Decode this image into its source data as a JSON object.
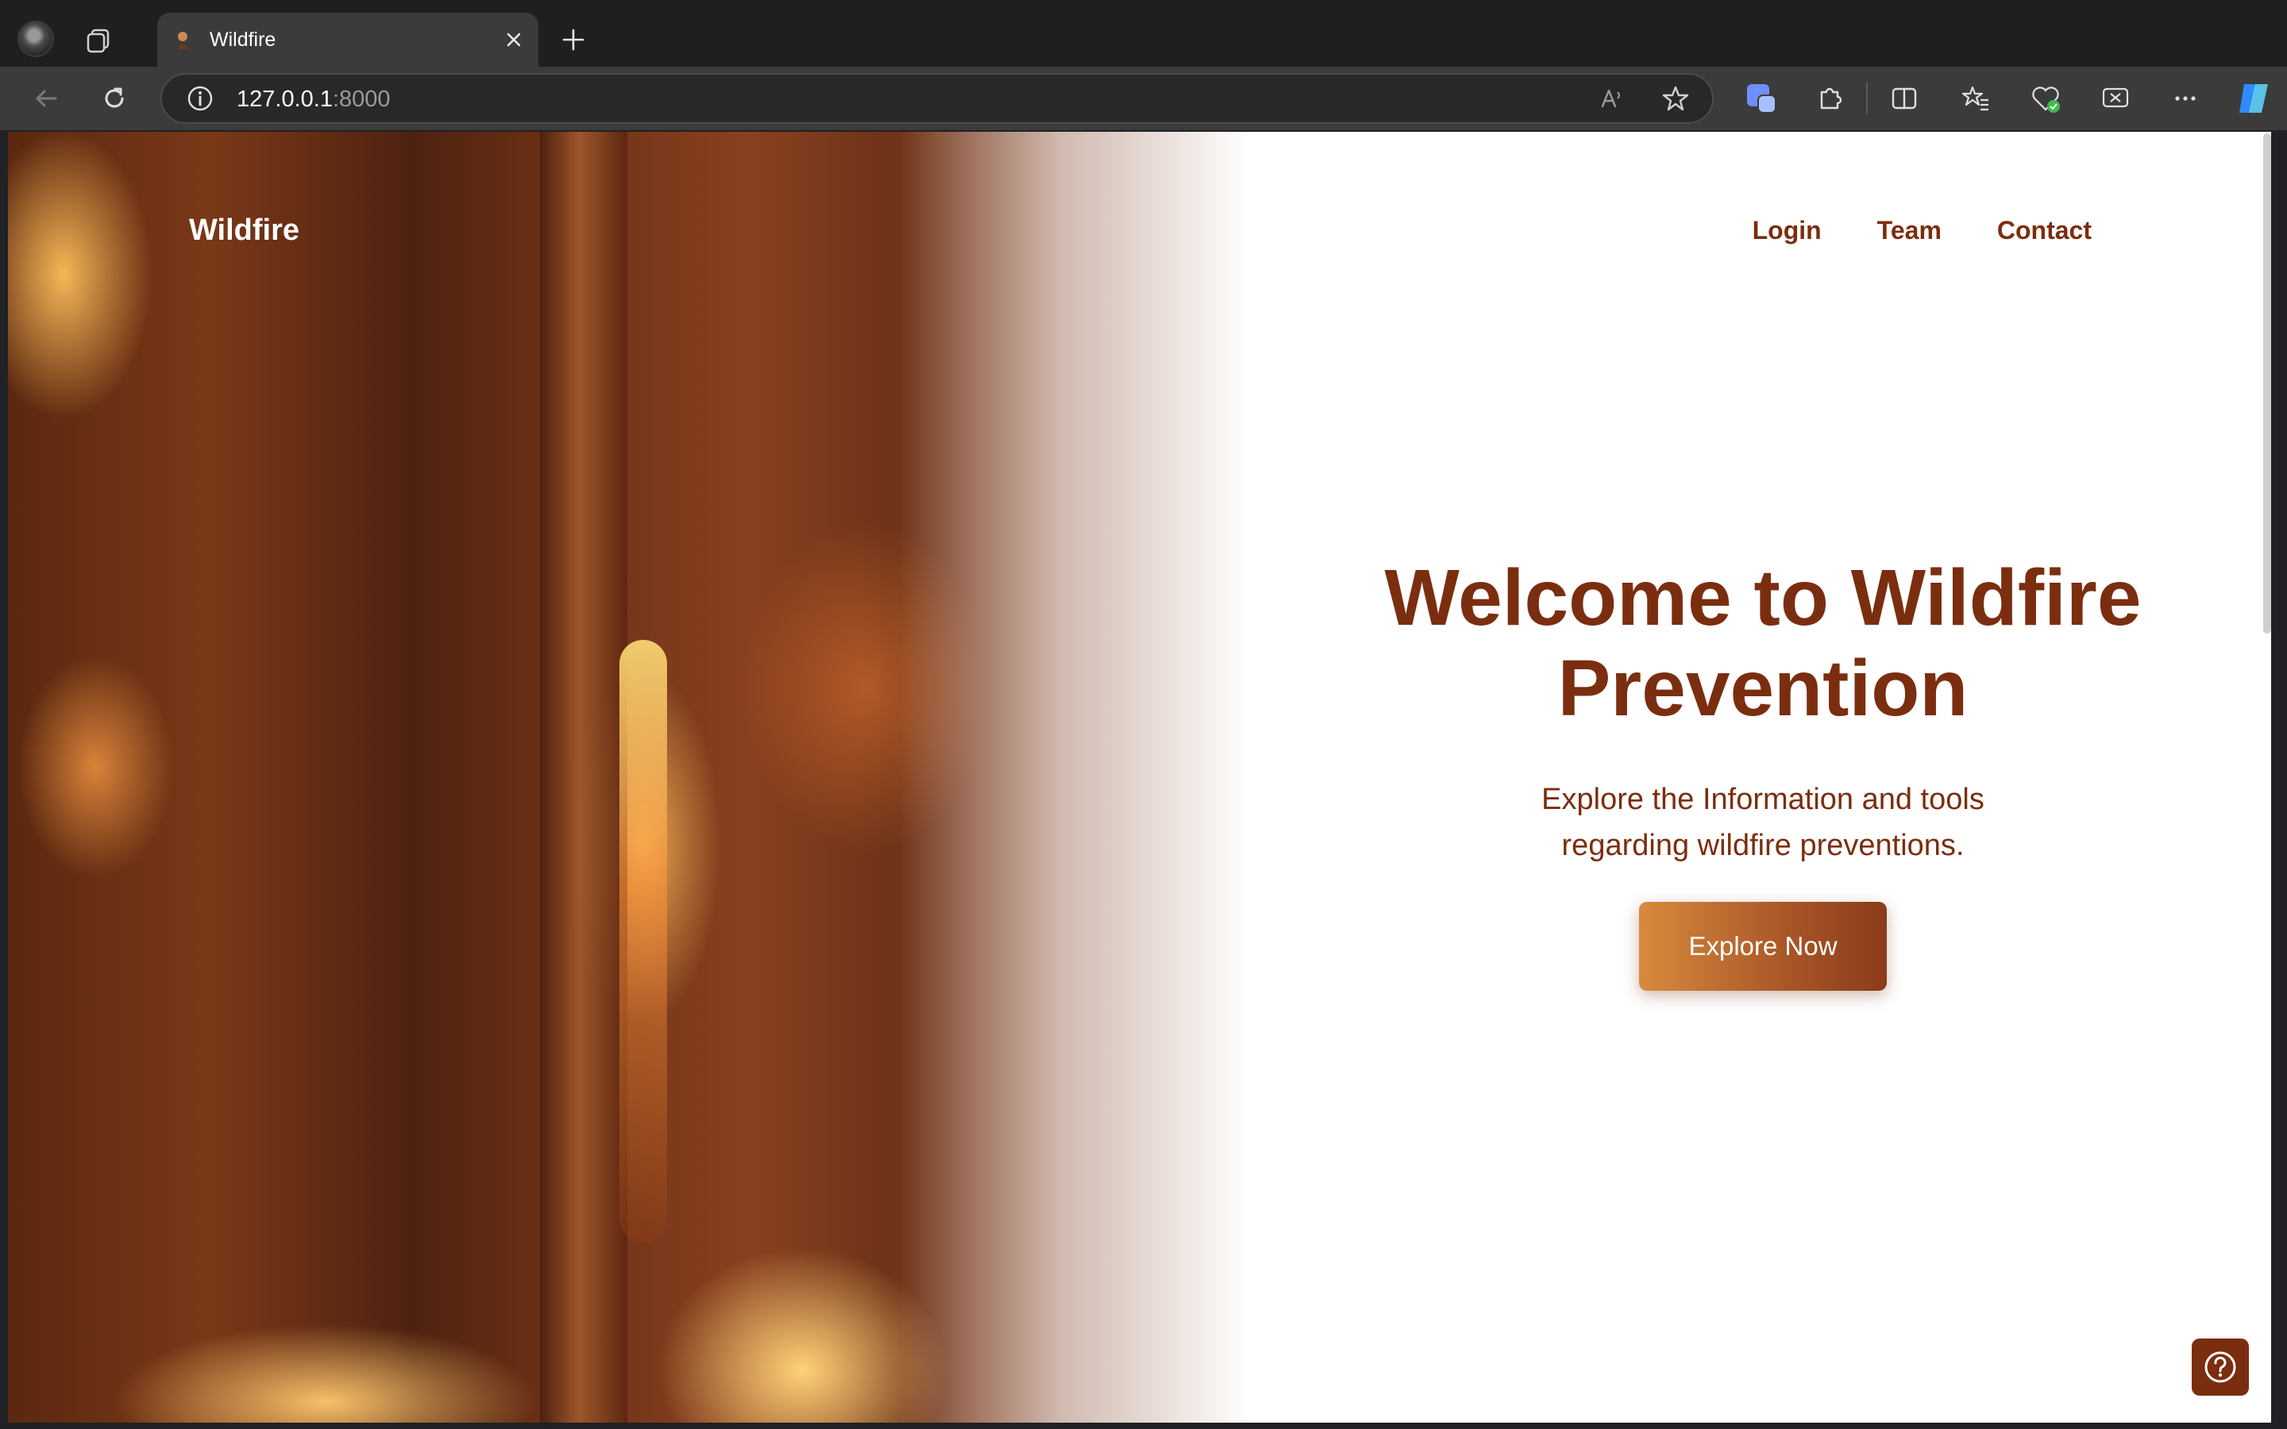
{
  "browser": {
    "tab_title": "Wildfire",
    "url_host": "127.0.0.1",
    "url_port": ":8000"
  },
  "page": {
    "brand": "Wildfire",
    "nav": [
      "Login",
      "Team",
      "Contact"
    ],
    "hero": {
      "title": "Welcome to Wildfire Prevention",
      "subtitle": "Explore the Information and tools regarding wildfire preventions.",
      "cta_label": "Explore Now"
    }
  },
  "colors": {
    "brand_brown": "#7a2e0f",
    "cta_gradient_start": "#d88a3e",
    "cta_gradient_end": "#8a3b1a"
  },
  "icons": {
    "help": "question-circle-icon"
  }
}
